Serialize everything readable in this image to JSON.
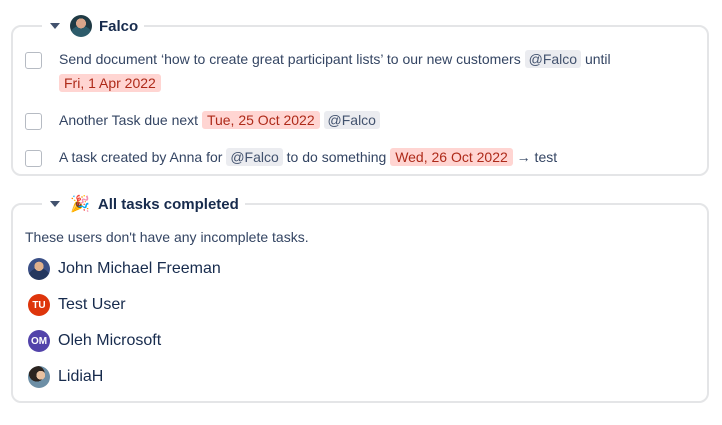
{
  "colors": {
    "mention_bg": "#ebecf0",
    "date_bg": "#ffd5d2",
    "date_text": "#ae2a19",
    "tu": "#de350b",
    "om": "#5243aa"
  },
  "falco_group": {
    "title": "Falco",
    "tasks": [
      {
        "prefix": "Send document ‘how to create great participant lists’ to our new customers",
        "mention": "@Falco",
        "suffix": "until",
        "date": "Fri, 1 Apr 2022"
      },
      {
        "prefix": "Another Task due next",
        "date": "Tue, 25 Oct 2022",
        "mention": "@Falco"
      },
      {
        "prefix": "A task created by Anna for",
        "mention": "@Falco",
        "middle": "to do something",
        "date": "Wed, 26 Oct 2022",
        "suffix": "→ test"
      }
    ]
  },
  "done_group": {
    "icon": "🎉",
    "title": "All tasks completed",
    "note": "These users don't have any incomplete tasks.",
    "users": [
      {
        "name": "John Michael Freeman",
        "avatar": "photo"
      },
      {
        "name": "Test User",
        "initials": "TU"
      },
      {
        "name": "Oleh Microsoft",
        "initials": "OM"
      },
      {
        "name": "LidiaH",
        "avatar": "photo"
      }
    ]
  }
}
